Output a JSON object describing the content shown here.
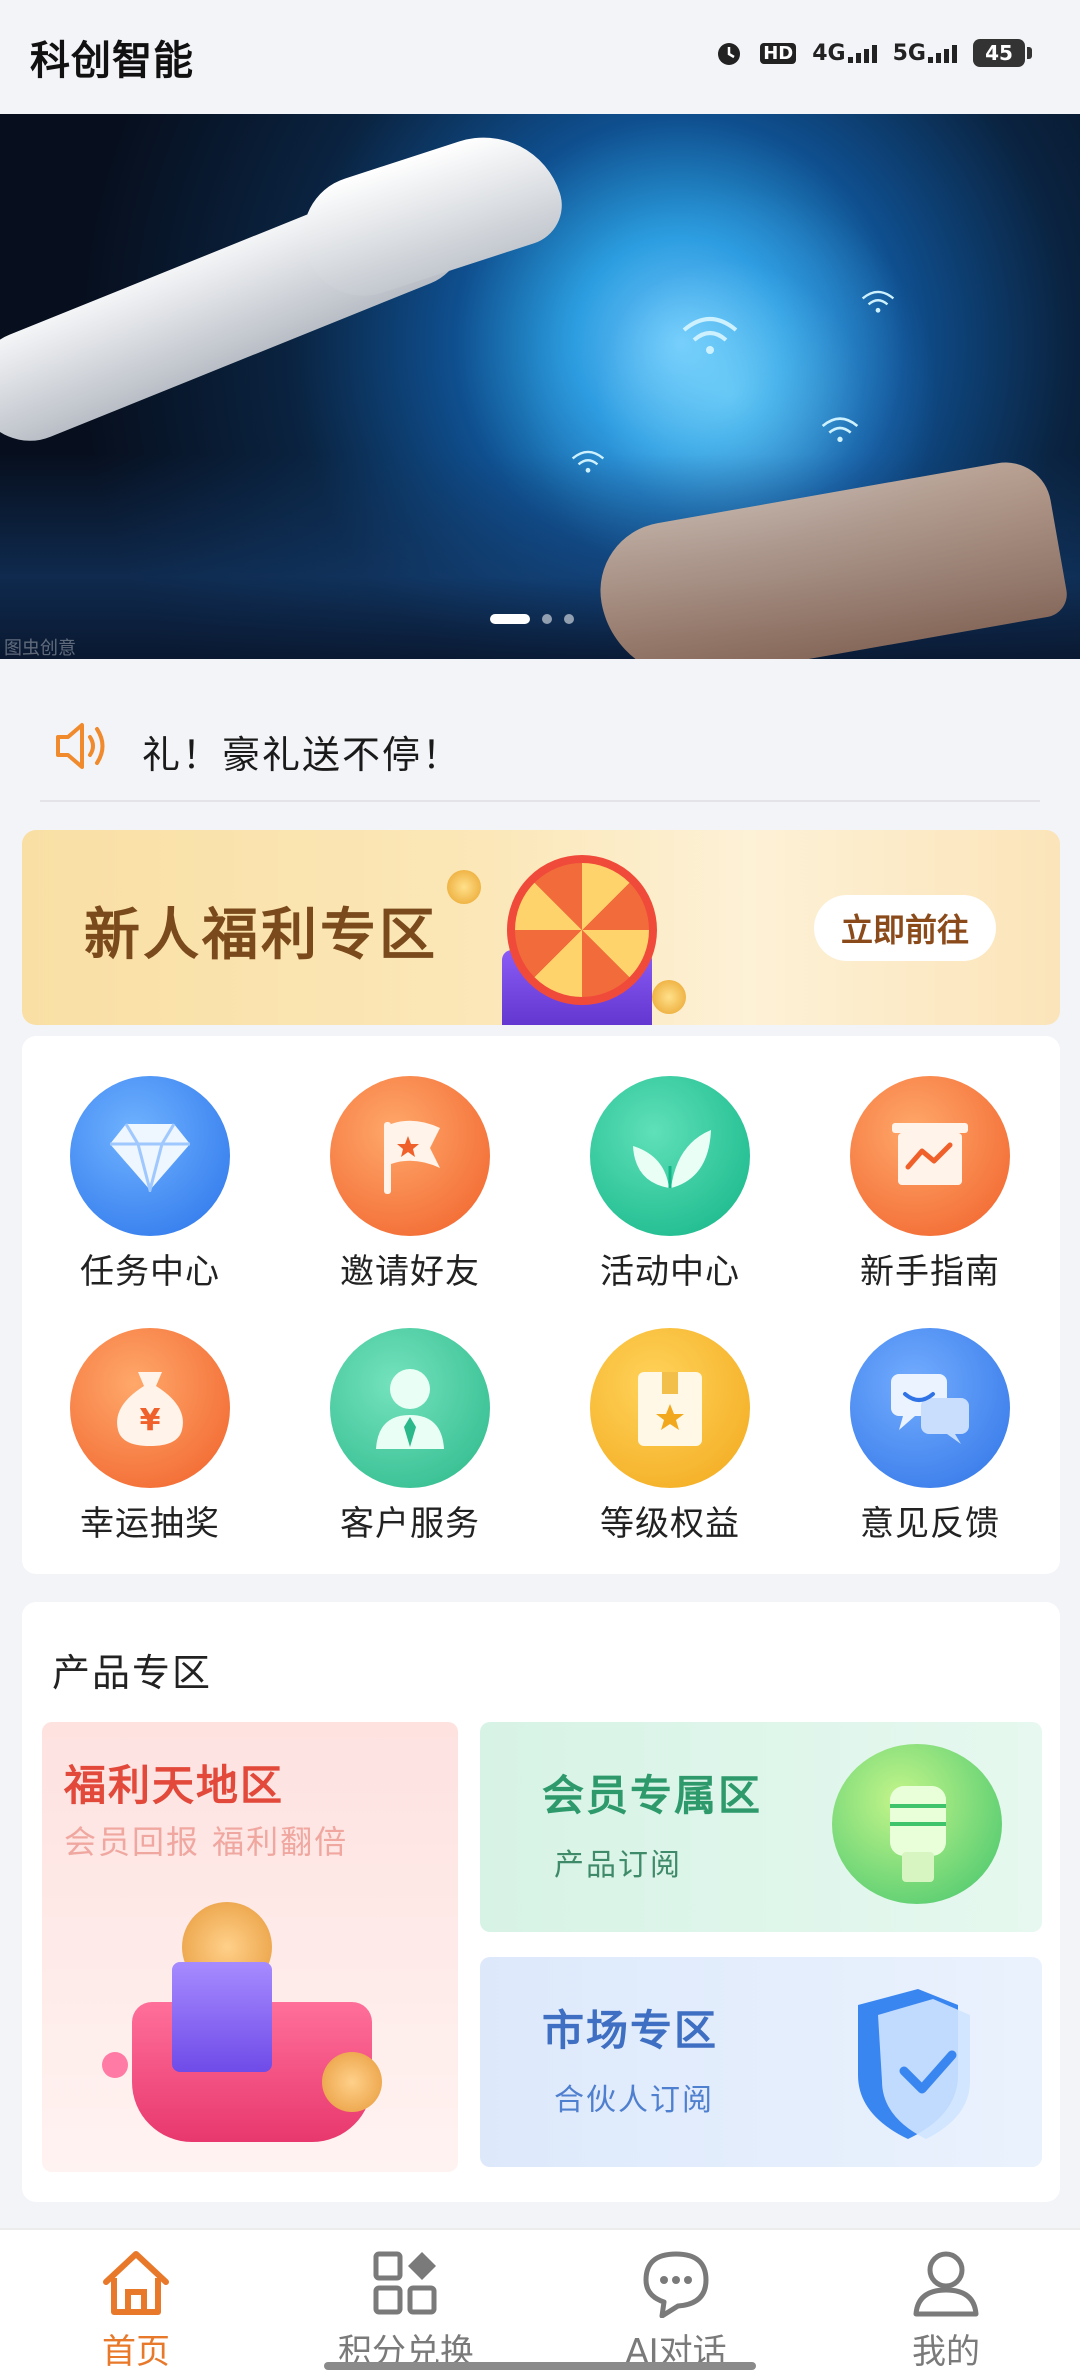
{
  "status_bar": {
    "app_title": "科创智能",
    "network_hd": "HD",
    "network_4g": "4G",
    "network_5g": "5G",
    "battery": "45"
  },
  "banner": {
    "watermark": "图虫创意",
    "page_count": 3,
    "active_page": 1
  },
  "notice": {
    "text": "礼！豪礼送不停！"
  },
  "welfare": {
    "title": "新人福利专区",
    "button": "立即前往"
  },
  "grid": [
    {
      "label": "任务中心",
      "icon": "diamond-icon",
      "color": "#3a8cf5"
    },
    {
      "label": "邀请好友",
      "icon": "flag-icon",
      "color": "#f4733a"
    },
    {
      "label": "活动中心",
      "icon": "leaf-icon",
      "color": "#22c49a"
    },
    {
      "label": "新手指南",
      "icon": "chart-board-icon",
      "color": "#f4733a"
    },
    {
      "label": "幸运抽奖",
      "icon": "money-bag-icon",
      "color": "#f4733a"
    },
    {
      "label": "客户服务",
      "icon": "agent-icon",
      "color": "#3fc49a"
    },
    {
      "label": "等级权益",
      "icon": "star-box-icon",
      "color": "#f5b82a"
    },
    {
      "label": "意见反馈",
      "icon": "chat-bubbles-icon",
      "color": "#3d86f0"
    }
  ],
  "products": {
    "title": "产品专区",
    "tile_a": {
      "title": "福利天地区",
      "sub": "会员回报 福利翻倍"
    },
    "tile_b": {
      "title": "会员专属区",
      "sub": "产品订阅"
    },
    "tile_c": {
      "title": "市场专区",
      "sub": "合伙人订阅"
    }
  },
  "nav": {
    "home": "首页",
    "points": "积分兑换",
    "ai": "AI对话",
    "mine": "我的",
    "active_color": "#e8782a",
    "inactive_color": "#7a7a7a"
  }
}
